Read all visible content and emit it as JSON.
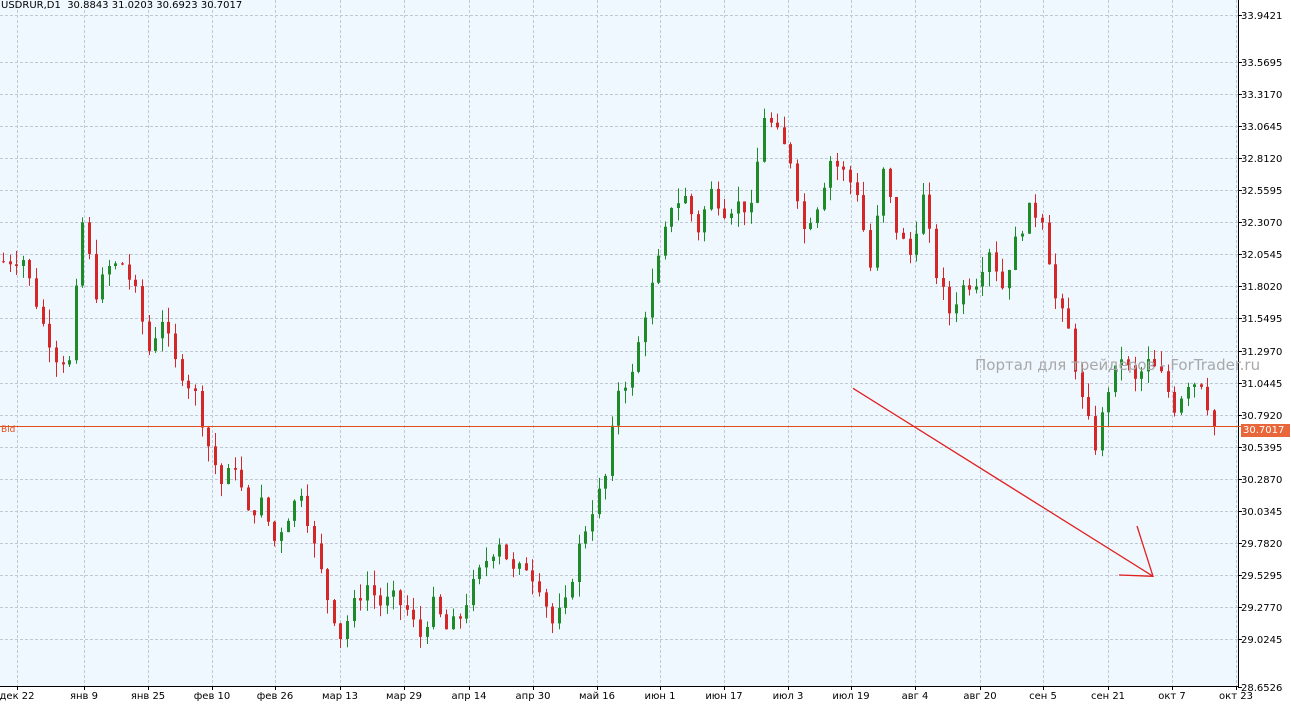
{
  "header": {
    "symbol": "USDRUR,D1",
    "open": "30.8843",
    "high": "31.0203",
    "low": "30.6923",
    "close": "30.7017"
  },
  "watermark": "Портал для трейдеров - ForTrader.ru",
  "bid": {
    "label": "Bid",
    "value": "30.7017"
  },
  "colors": {
    "background": "#f0f8ff",
    "grid": "#c0c8d4",
    "bull": "#1e8a28",
    "bear": "#d42828",
    "bid_line": "#e0501e",
    "arrow": "#e02020"
  },
  "chart_data": {
    "type": "candlestick",
    "ylim": [
      28.6526,
      33.9421
    ],
    "y_ticks": [
      "33.9421",
      "33.5695",
      "33.3170",
      "33.0645",
      "32.8120",
      "32.5595",
      "32.3070",
      "32.0545",
      "31.8020",
      "31.5495",
      "31.2970",
      "31.0445",
      "30.7920",
      "30.5395",
      "30.2870",
      "30.0345",
      "29.7820",
      "29.5295",
      "29.2770",
      "29.0245",
      "28.6526"
    ],
    "x_ticks": [
      "дек 22",
      "янв 9",
      "янв 25",
      "фев 10",
      "фев 26",
      "мар 13",
      "мар 29",
      "апр 14",
      "апр 30",
      "май 16",
      "июн 1",
      "июн 17",
      "июл 3",
      "июл 19",
      "авг 4",
      "авг 20",
      "сен 5",
      "сен 21",
      "окт 7",
      "окт 23"
    ],
    "bid": 30.7017,
    "annotation": {
      "type": "arrow",
      "from": [
        0.0,
        31.0
      ],
      "to": [
        1.0,
        29.52
      ]
    },
    "candles": []
  }
}
